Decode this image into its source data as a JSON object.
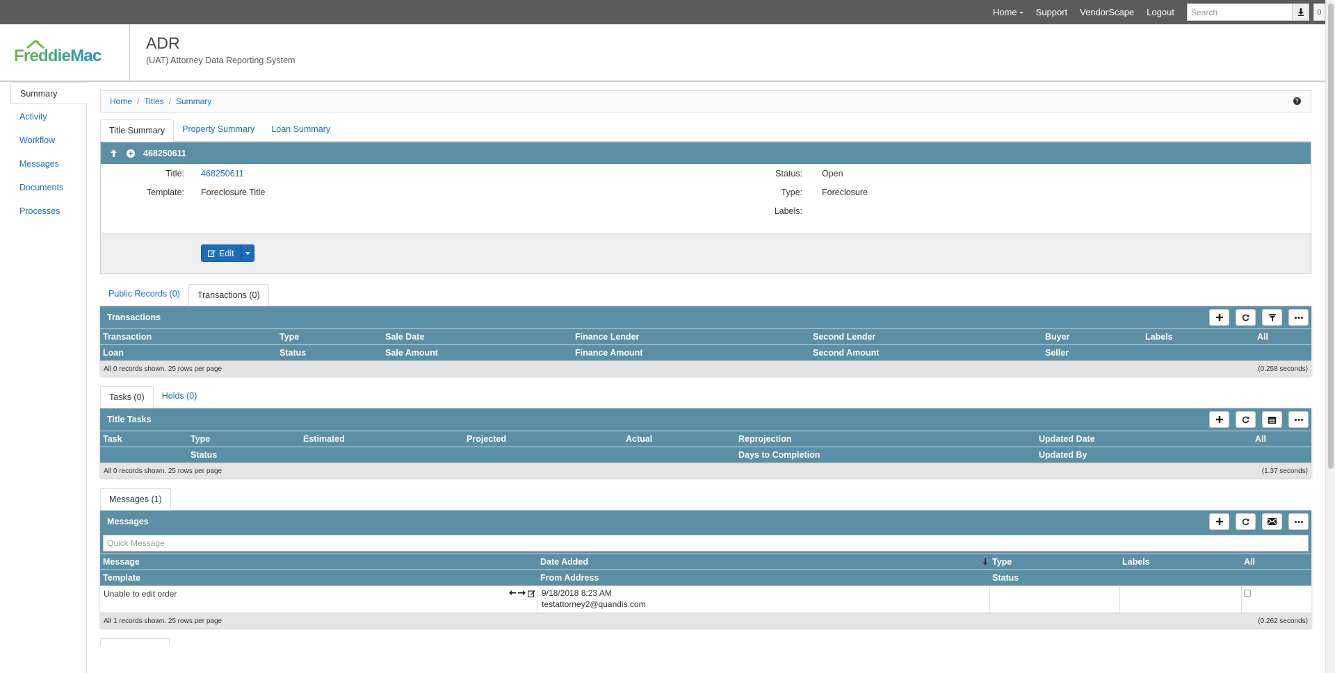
{
  "topnav": {
    "home": "Home",
    "support": "Support",
    "vendorscape": "VendorScape",
    "logout": "Logout",
    "search_placeholder": "Search",
    "count": "0"
  },
  "header": {
    "logo_text": "FreddieMac",
    "title": "ADR",
    "subtitle": "(UAT) Attorney Data Reporting System"
  },
  "sidebar": {
    "items": [
      {
        "label": "Summary"
      },
      {
        "label": "Activity"
      },
      {
        "label": "Workflow"
      },
      {
        "label": "Messages"
      },
      {
        "label": "Documents"
      },
      {
        "label": "Processes"
      }
    ]
  },
  "breadcrumb": [
    "Home",
    "Titles",
    "Summary"
  ],
  "summary_tabs": [
    "Title Summary",
    "Property Summary",
    "Loan Summary"
  ],
  "title_panel": {
    "id": "468250611",
    "title_label": "Title:",
    "title_value": "468250611",
    "template_label": "Template:",
    "template_value": "Foreclosure Title",
    "status_label": "Status:",
    "status_value": "Open",
    "type_label": "Type:",
    "type_value": "Foreclosure",
    "labels_label": "Labels:",
    "edit_label": "Edit"
  },
  "records_tabs": [
    "Public Records (0)",
    "Transactions (0)"
  ],
  "transactions": {
    "title": "Transactions",
    "row1": [
      "Transaction",
      "Type",
      "Sale Date",
      "Finance Lender",
      "Second Lender",
      "Buyer",
      "Labels",
      "All"
    ],
    "row2": [
      "Loan",
      "Status",
      "Sale Amount",
      "Finance Amount",
      "Second Amount",
      "Seller"
    ],
    "footer_left": "All 0 records shown. 25 rows per page",
    "footer_right": "(0.258 seconds)"
  },
  "task_tabs": [
    "Tasks (0)",
    "Holds (0)"
  ],
  "tasks": {
    "title": "Title Tasks",
    "row1": [
      "Task",
      "Type",
      "Estimated",
      "Projected",
      "Actual",
      "Reprojection",
      "Updated Date",
      "All"
    ],
    "row2": [
      "Status",
      "Days to Completion",
      "Updated By"
    ],
    "footer_left": "All 0 records shown. 25 rows per page",
    "footer_right": "(1.37 seconds)"
  },
  "message_tabs": [
    "Messages (1)"
  ],
  "messages": {
    "title": "Messages",
    "quick_placeholder": "Quick Message",
    "row1": [
      "Message",
      "Date Added",
      "Type",
      "Labels",
      "All"
    ],
    "row2": [
      "Template",
      "From Address",
      "Status"
    ],
    "items": [
      {
        "message": "Unable to edit order",
        "date": "9/18/2018 8:23 AM",
        "from": "testattorney2@quandis.com"
      }
    ],
    "footer_left": "All 1 records shown. 25 rows per page",
    "footer_right": "(0.262 seconds)"
  },
  "colors": {
    "topbar": "#5c5c5c",
    "panel_header": "#5b8fa5",
    "link": "#1a6dbb",
    "logo_green": "#6dbb45",
    "logo_blue": "#1d8fc9"
  }
}
